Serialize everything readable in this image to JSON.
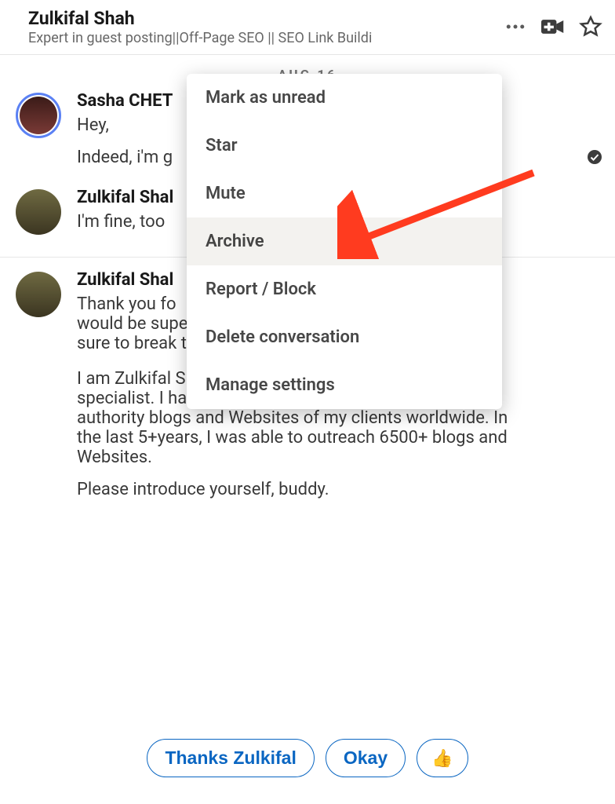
{
  "header": {
    "title": "Zulkifal Shah",
    "subtitle": "Expert in guest posting||Off-Page SEO || SEO Link Buildi"
  },
  "date_separator": "AUG 16",
  "messages": [
    {
      "sender": "Sasha CHET",
      "lines": [
        "Hey,",
        "Indeed, i'm g"
      ],
      "avatar": "ring",
      "has_check": true
    },
    {
      "sender": "Zulkifal Shal",
      "lines": [
        "I'm fine, too"
      ],
      "avatar": "man",
      "has_check": false
    },
    {
      "sender": "Zulkifal Shal",
      "lines": [
        "Thank you fo",
        "would be super awesome to share our thoughts. I'll be sure to break the ice and introduce myself.",
        "I am Zulkifal Shahid, SEO and Guest Blog Outreach specialist. I have been outreaching different high-authority blogs and Websites of my clients worldwide. In the last 5+years, I was able to outreach 6500+ blogs and Websites.",
        "Please introduce yourself, buddy."
      ],
      "avatar": "man",
      "has_check": false
    }
  ],
  "menu": {
    "items": [
      {
        "label": "Mark as unread",
        "hover": false
      },
      {
        "label": "Star",
        "hover": false
      },
      {
        "label": "Mute",
        "hover": false
      },
      {
        "label": "Archive",
        "hover": true
      },
      {
        "label": "Report / Block",
        "hover": false
      },
      {
        "label": "Delete conversation",
        "hover": false
      },
      {
        "label": "Manage settings",
        "hover": false
      }
    ]
  },
  "quick_replies": {
    "r1": "Thanks Zulkifal",
    "r2": "Okay",
    "r3": "👍"
  }
}
